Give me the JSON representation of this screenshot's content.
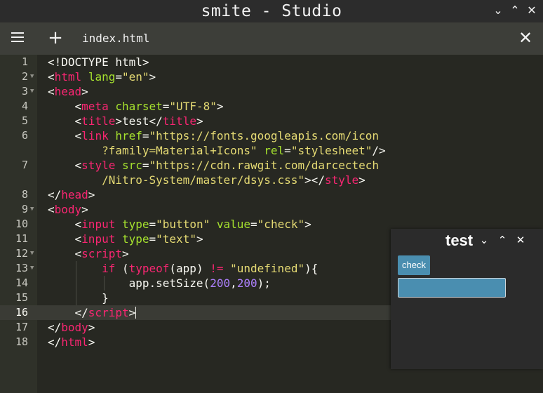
{
  "window": {
    "title": "smite - Studio",
    "controls": [
      "minimize",
      "maximize",
      "close"
    ]
  },
  "toolbar": {
    "menu_icon": "hamburger-menu-icon",
    "add_icon": "plus-icon",
    "tab_label": "index.html",
    "close_icon": "close-icon"
  },
  "editor": {
    "active_line": 16,
    "lines": [
      {
        "num": "1"
      },
      {
        "num": "2"
      },
      {
        "num": "3"
      },
      {
        "num": "4"
      },
      {
        "num": "5"
      },
      {
        "num": "6"
      },
      {
        "num": "7"
      },
      {
        "num": "8"
      },
      {
        "num": "9"
      },
      {
        "num": "10"
      },
      {
        "num": "11"
      },
      {
        "num": "12"
      },
      {
        "num": "13"
      },
      {
        "num": "14"
      },
      {
        "num": "15"
      },
      {
        "num": "16"
      },
      {
        "num": "17"
      },
      {
        "num": "18"
      }
    ],
    "fold_markers": [
      2,
      3,
      9,
      12,
      13
    ]
  },
  "preview": {
    "title": "test",
    "button_value": "check",
    "input_value": ""
  },
  "colors": {
    "background": "#272822",
    "gutter": "#2f3129",
    "tag": "#f92672",
    "attribute": "#a6e22e",
    "string": "#e6db74",
    "number": "#ae81ff",
    "accent_blue": "#4a8eb0"
  }
}
